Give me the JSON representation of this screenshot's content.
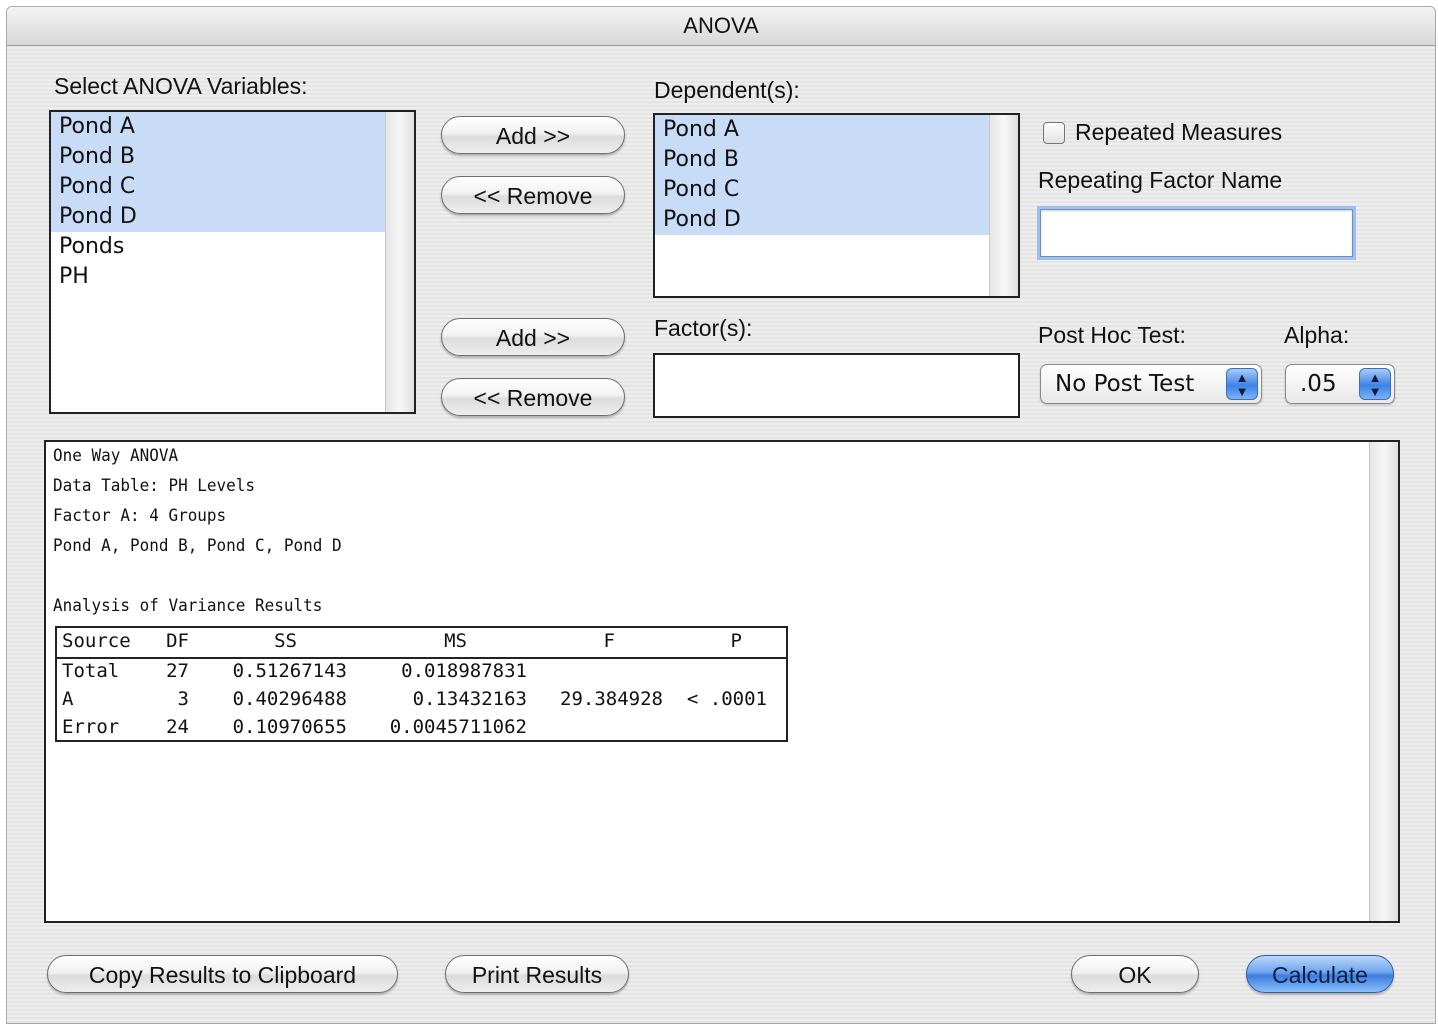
{
  "window": {
    "title": "ANOVA"
  },
  "variables": {
    "label": "Select ANOVA Variables:",
    "items": [
      {
        "label": "Pond A",
        "selected": true
      },
      {
        "label": "Pond B",
        "selected": true
      },
      {
        "label": "Pond C",
        "selected": true
      },
      {
        "label": "Pond D",
        "selected": true
      },
      {
        "label": "Ponds",
        "selected": false
      },
      {
        "label": "PH",
        "selected": false
      }
    ]
  },
  "dependents": {
    "label": "Dependent(s):",
    "add_label": "Add >>",
    "remove_label": "<< Remove",
    "items": [
      {
        "label": "Pond A",
        "selected": true
      },
      {
        "label": "Pond B",
        "selected": true
      },
      {
        "label": "Pond C",
        "selected": true
      },
      {
        "label": "Pond D",
        "selected": true
      }
    ]
  },
  "factors": {
    "label": "Factor(s):",
    "add_label": "Add >>",
    "remove_label": "<< Remove"
  },
  "repeated": {
    "checkbox_label": "Repeated Measures",
    "checked": false,
    "factor_name_label": "Repeating Factor Name",
    "factor_name_value": ""
  },
  "post_hoc": {
    "label": "Post Hoc Test:",
    "value": "No Post Test"
  },
  "alpha": {
    "label": "Alpha:",
    "value": ".05"
  },
  "results": {
    "lines": [
      "One Way ANOVA",
      "Data Table: PH Levels",
      "Factor A: 4 Groups",
      "Pond A,  Pond B,  Pond C,  Pond D",
      "",
      "Analysis of Variance Results"
    ],
    "table": {
      "headers": [
        "Source",
        "DF",
        "SS",
        "MS",
        "F",
        "P"
      ],
      "rows": [
        [
          "Total",
          "27",
          "0.51267143",
          "0.018987831",
          "",
          ""
        ],
        [
          "A",
          "3",
          "0.40296488",
          "0.13432163",
          "29.384928",
          "< .0001"
        ],
        [
          "Error",
          "24",
          "0.10970655",
          "0.0045711062",
          "",
          ""
        ]
      ]
    }
  },
  "buttons": {
    "copy": "Copy Results to Clipboard",
    "print": "Print Results",
    "ok": "OK",
    "calculate": "Calculate"
  },
  "colors": {
    "selection": "#c8dcf8",
    "default_button": "#3d7de0",
    "focus_ring": "#9fc0ee"
  }
}
